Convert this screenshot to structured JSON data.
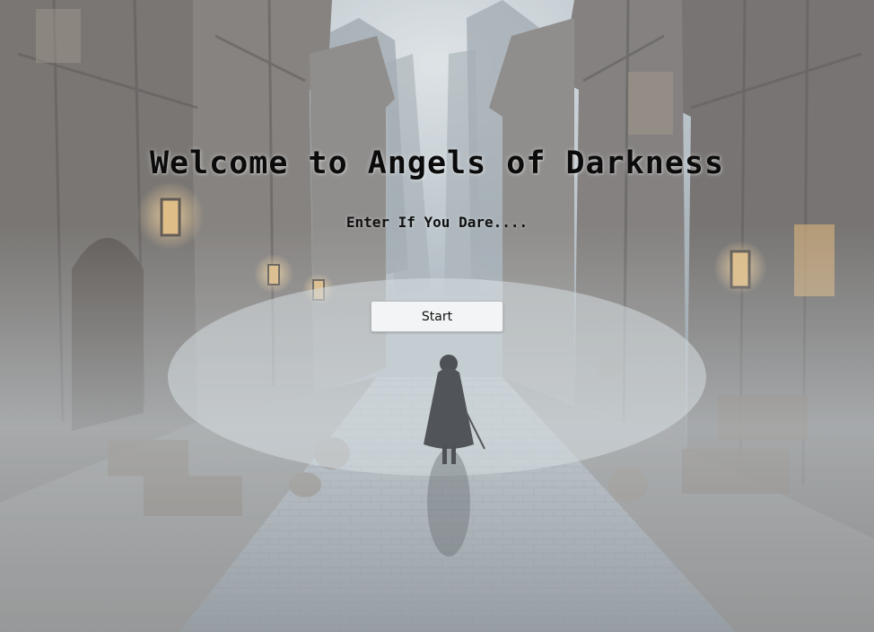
{
  "page": {
    "title": "Welcome to Angels of Darkness",
    "subtitle": "Enter If You Dare....",
    "start_label": "Start"
  },
  "colors": {
    "title_text": "#0b0b0b",
    "button_bg": "#f3f4f5",
    "fog": "#c8cdd2"
  },
  "background": {
    "scene": "foggy-medieval-alley-with-cloaked-figure"
  }
}
